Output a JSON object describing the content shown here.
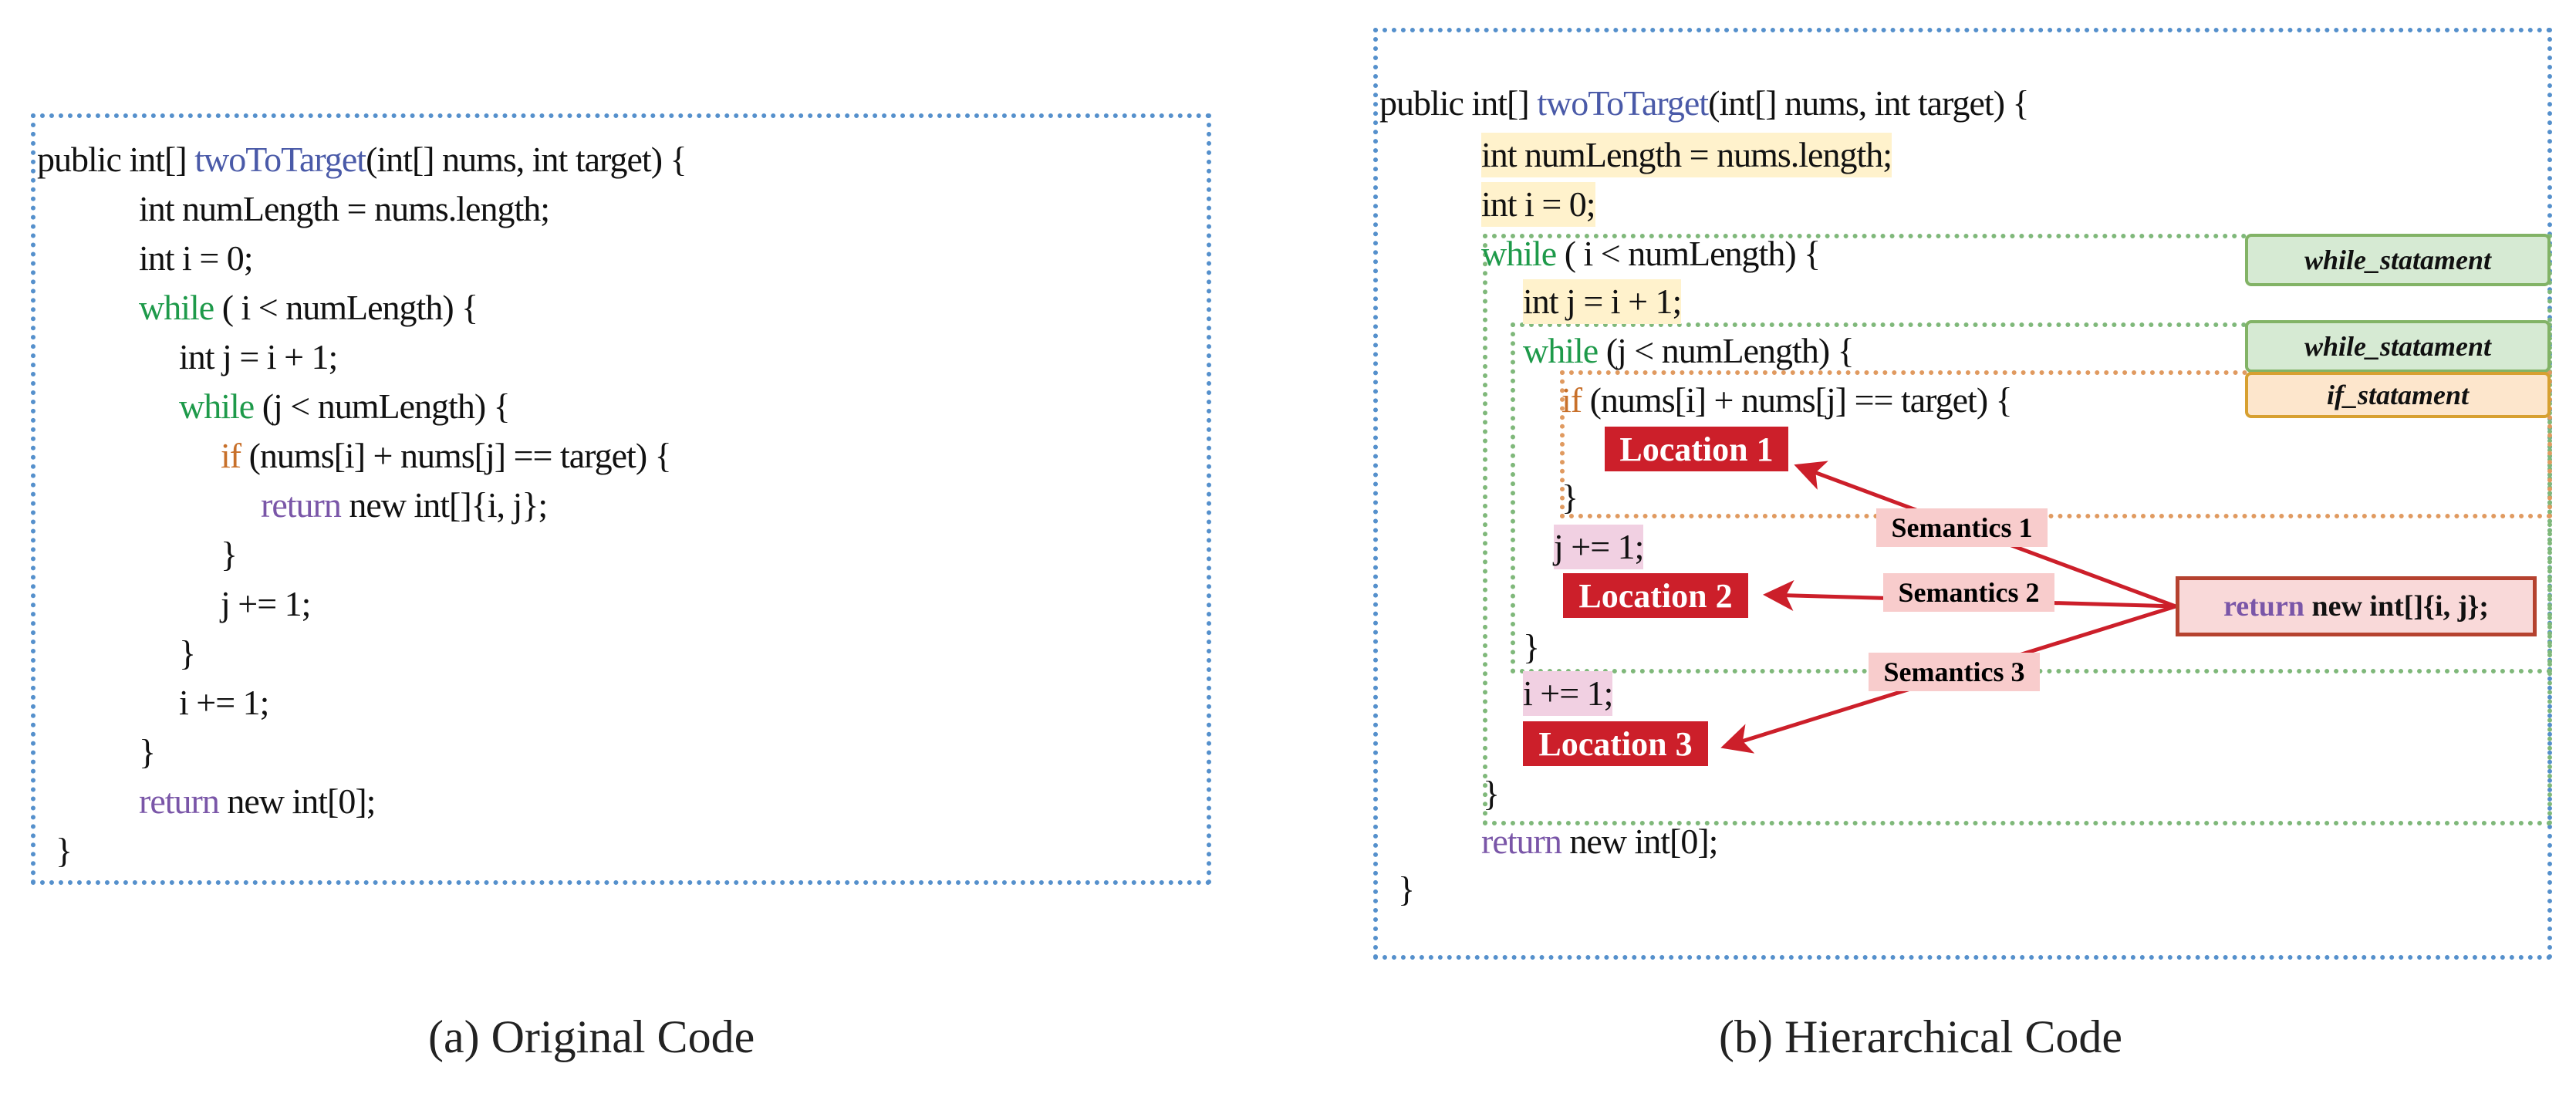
{
  "original": {
    "caption": "(a)  Original Code",
    "lines": [
      {
        "pre": "public int[] ",
        "kw": "twoToTarget",
        "kwType": "fn",
        "post": "(int[] nums, int target) {"
      },
      {
        "pre": "",
        "kw": "",
        "kwType": "",
        "post": "int numLength = nums.length;"
      },
      {
        "pre": "",
        "kw": "",
        "kwType": "",
        "post": "int i = 0;"
      },
      {
        "pre": "",
        "kw": "while",
        "kwType": "while",
        "post": " ( i < numLength) {"
      },
      {
        "pre": "",
        "kw": "",
        "kwType": "",
        "post": "int j = i + 1;"
      },
      {
        "pre": "",
        "kw": "while",
        "kwType": "while",
        "post": " (j < numLength) {"
      },
      {
        "pre": "",
        "kw": "if",
        "kwType": "if",
        "post": " (nums[i] + nums[j] == target) {"
      },
      {
        "pre": "",
        "kw": "return",
        "kwType": "ret",
        "post": " new int[]{i, j};"
      },
      {
        "pre": "",
        "kw": "",
        "kwType": "",
        "post": "}"
      },
      {
        "pre": "",
        "kw": "",
        "kwType": "",
        "post": "j += 1;"
      },
      {
        "pre": "",
        "kw": "",
        "kwType": "",
        "post": "}"
      },
      {
        "pre": "",
        "kw": "",
        "kwType": "",
        "post": "i += 1;"
      },
      {
        "pre": "",
        "kw": "",
        "kwType": "",
        "post": "}"
      },
      {
        "pre": "",
        "kw": "return",
        "kwType": "ret",
        "post": " new int[0];"
      },
      {
        "pre": "",
        "kw": "",
        "kwType": "",
        "post": "}"
      }
    ]
  },
  "hierarchical": {
    "caption": "(b)  Hierarchical Code",
    "lines": [
      {
        "pre": "public int[] ",
        "kw": "twoToTarget",
        "kwType": "fn",
        "post": "(int[] nums, int target) {",
        "hl": ""
      },
      {
        "pre": "",
        "kw": "",
        "kwType": "",
        "post": "int numLength = nums.length;",
        "hl": "yellow"
      },
      {
        "pre": "",
        "kw": "",
        "kwType": "",
        "post": "int i = 0;",
        "hl": "yellow"
      },
      {
        "pre": "",
        "kw": "while",
        "kwType": "while",
        "post": " ( i < numLength) {",
        "hl": ""
      },
      {
        "pre": "",
        "kw": "",
        "kwType": "",
        "post": "int j = i + 1;",
        "hl": "yellow"
      },
      {
        "pre": "",
        "kw": "while",
        "kwType": "while",
        "post": " (j < numLength) {",
        "hl": ""
      },
      {
        "pre": "",
        "kw": "if",
        "kwType": "if",
        "post": " (nums[i] + nums[j] == target) {",
        "hl": ""
      },
      {
        "pre": "",
        "kw": "",
        "kwType": "",
        "post": "}",
        "hl": ""
      },
      {
        "pre": "",
        "kw": "",
        "kwType": "",
        "post": "j += 1;",
        "hl": "pink"
      },
      {
        "pre": "",
        "kw": "",
        "kwType": "",
        "post": "}",
        "hl": ""
      },
      {
        "pre": "",
        "kw": "",
        "kwType": "",
        "post": "i += 1;",
        "hl": "pink"
      },
      {
        "pre": "",
        "kw": "",
        "kwType": "",
        "post": "}",
        "hl": ""
      },
      {
        "pre": "",
        "kw": "return",
        "kwType": "ret",
        "post": " new int[0];",
        "hl": ""
      },
      {
        "pre": "",
        "kw": "",
        "kwType": "",
        "post": "}",
        "hl": ""
      }
    ],
    "tags": {
      "outer_while": "while_statament",
      "inner_while": "while_statament",
      "if": "if_statament"
    },
    "locations": [
      "Location 1",
      "Location 2",
      "Location 3"
    ],
    "semantics": [
      "Semantics 1",
      "Semantics 2",
      "Semantics 3"
    ],
    "inserted_statement": {
      "kw": "return",
      "rest": " new int[]{i, j};"
    }
  },
  "colors": {
    "panel_border": "#5590cc",
    "fn_name": "#4a5aa8",
    "while_kw": "#1e9a4a",
    "if_kw": "#c8702a",
    "return_kw": "#7a56a8",
    "location_bg": "#cc1f2a",
    "semantics_bg": "#f8cccc",
    "arrow": "#cc1f2a"
  }
}
